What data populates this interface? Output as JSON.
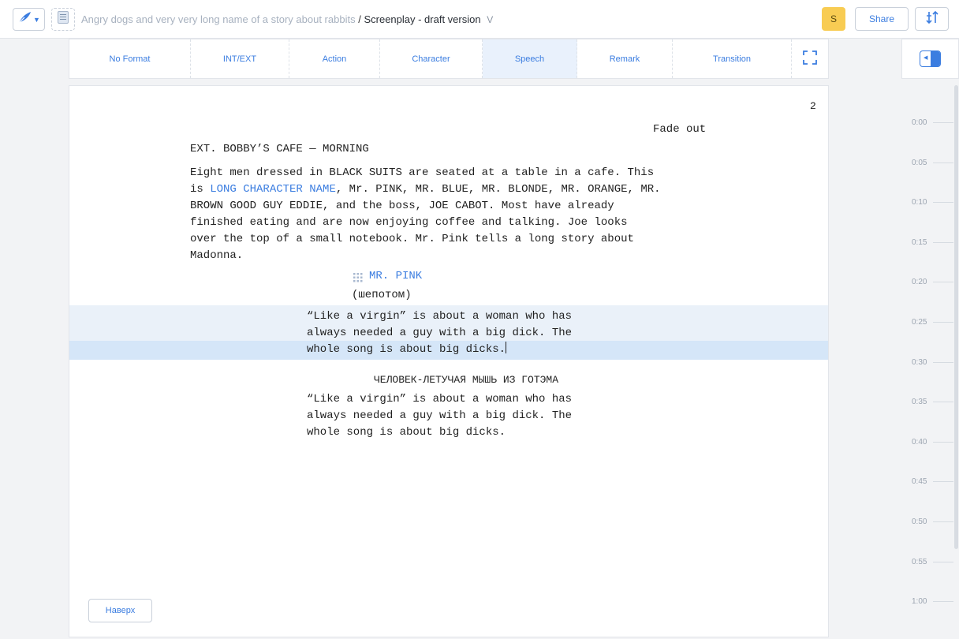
{
  "header": {
    "project_name": "Angry dogs and very very long name of a story about rabbits",
    "separator": "/",
    "document_name": "Screenplay - draft version",
    "chevron": "V",
    "avatar_initial": "S",
    "share_label": "Share",
    "icons": [
      "feather-icon",
      "chevron-down-icon",
      "document-icon",
      "sort-icon"
    ]
  },
  "format_bar": {
    "items": [
      {
        "label": "No Format"
      },
      {
        "label": "INT/EXT"
      },
      {
        "label": "Action"
      },
      {
        "label": "Character"
      },
      {
        "label": "Speech",
        "active": true
      },
      {
        "label": "Remark"
      },
      {
        "label": "Transition"
      }
    ],
    "fullscreen_icon": "fullscreen-icon"
  },
  "timeline": {
    "ticks": [
      "0:00",
      "0:05",
      "0:10",
      "0:15",
      "0:20",
      "0:25",
      "0:30",
      "0:35",
      "0:40",
      "0:45",
      "0:50",
      "0:55",
      "1:00"
    ]
  },
  "script": {
    "page_number": "2",
    "transition": "Fade out",
    "scene_heading": "EXT. BOBBY’S CAFE — MORNING",
    "action_line1": "Eight men dressed in BLACK SUITS are seated at a table in a cafe. This",
    "action_line2_prefix": "is ",
    "action_line2_link": "LONG CHARACTER NAME",
    "action_line2_suffix": ", Mr. PINK, MR. BLUE, MR. BLONDE, MR. ORANGE, MR.",
    "action_line3": "BROWN GOOD GUY EDDIE, and the boss, JOE CABOT. Most have already",
    "action_line4": "finished eating and are now enjoying coffee and talking. Joe looks",
    "action_line5": "over the top of a small notebook. Mr. Pink tells a long story about",
    "action_line6": "Madonna.",
    "character1": "MR. PINK",
    "remark1": "(шепотом)",
    "speech1_line1": "“Like a virgin” is about a woman who has",
    "speech1_line2": "always needed a guy with a big dick. The",
    "speech1_line3": "whole song is about big dicks.",
    "character2": "ЧЕЛОВЕК-ЛЕТУЧАЯ МЫШЬ ИЗ ГОТЭМА",
    "speech2_line1": "“Like a virgin” is about a woman who has",
    "speech2_line2": "always needed a guy with a big dick. The",
    "speech2_line3": "whole song is about big dicks."
  },
  "footer": {
    "up_button_label": "Наверх"
  },
  "colors": {
    "accent": "#3b7de0",
    "avatar": "#f8cc53",
    "selection": "#eaf1f9",
    "selection_line": "#d5e6f8"
  }
}
